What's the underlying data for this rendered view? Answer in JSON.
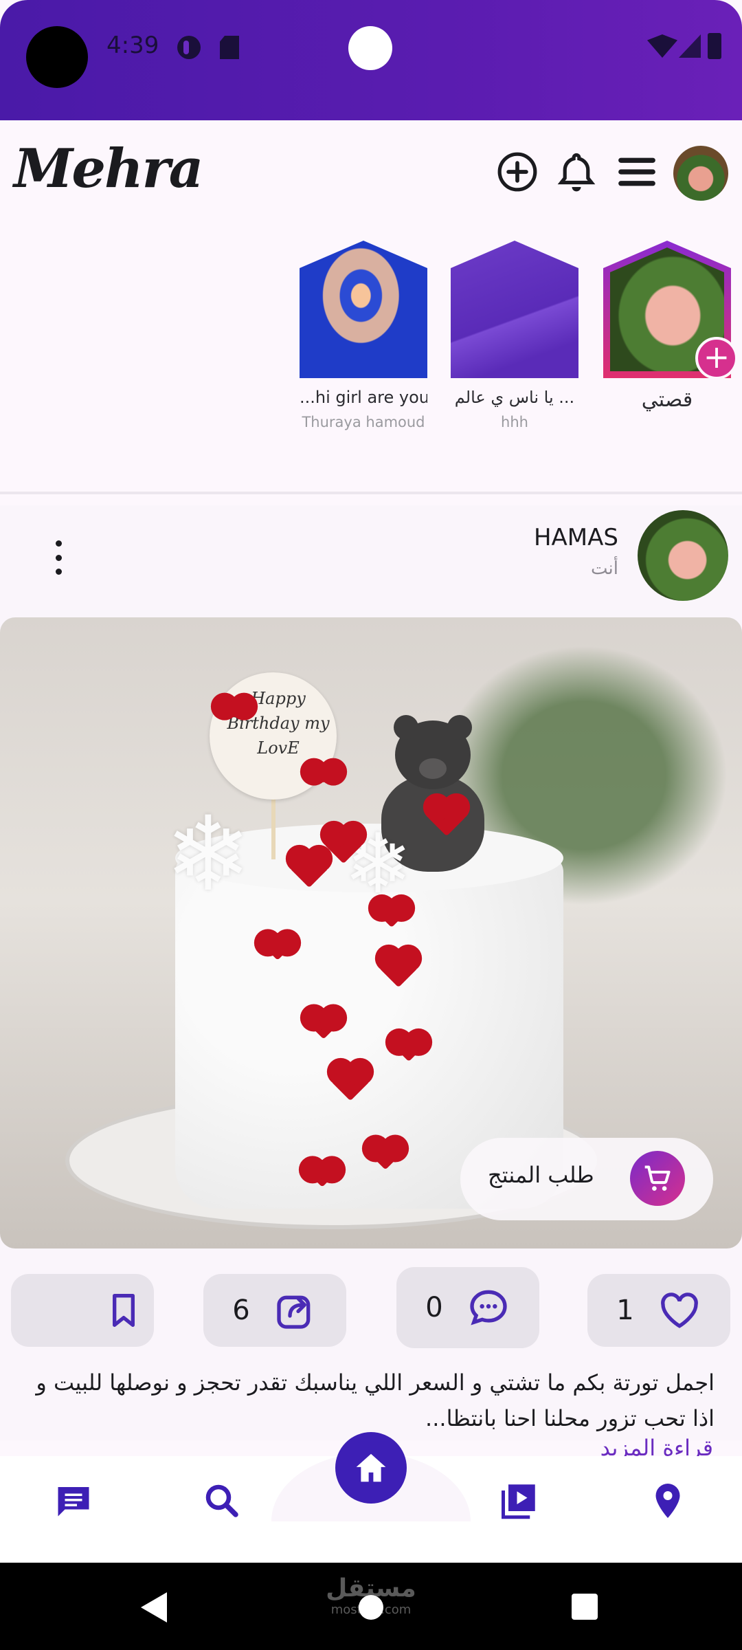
{
  "status_bar": {
    "time": "4:39"
  },
  "header": {
    "logo": "Mehra"
  },
  "stories": [
    {
      "caption": "قصتي",
      "author": ""
    },
    {
      "caption": "يا ناس ي عالم ...",
      "author": "hhh"
    },
    {
      "caption": "...hi girl are you",
      "author": "Thuraya hamoud"
    }
  ],
  "post": {
    "author": "HAMAS",
    "time_label": "أنت",
    "image": {
      "topper_text": "Happy Birthday my LovE"
    },
    "order_label": "طلب المنتج",
    "counts": {
      "likes": "1",
      "comments": "0",
      "shares": "6"
    },
    "caption": "اجمل تورتة بكم ما تشتي و السعر اللي يناسبك تقدر تحجز و نوصلها للبيت و اذا تحب تزور محلنا احنا بانتظا...",
    "read_more": "قراءة المزيد"
  },
  "bottom_nav": [
    "messages",
    "search",
    "home",
    "videos",
    "location"
  ],
  "watermark": {
    "arabic": "مستقل",
    "latin": "mostaql.com"
  },
  "colors": {
    "primary": "#3d1fb5",
    "accent": "#6a2bc0",
    "pink": "#d6308e",
    "background": "#fdf7fd"
  }
}
